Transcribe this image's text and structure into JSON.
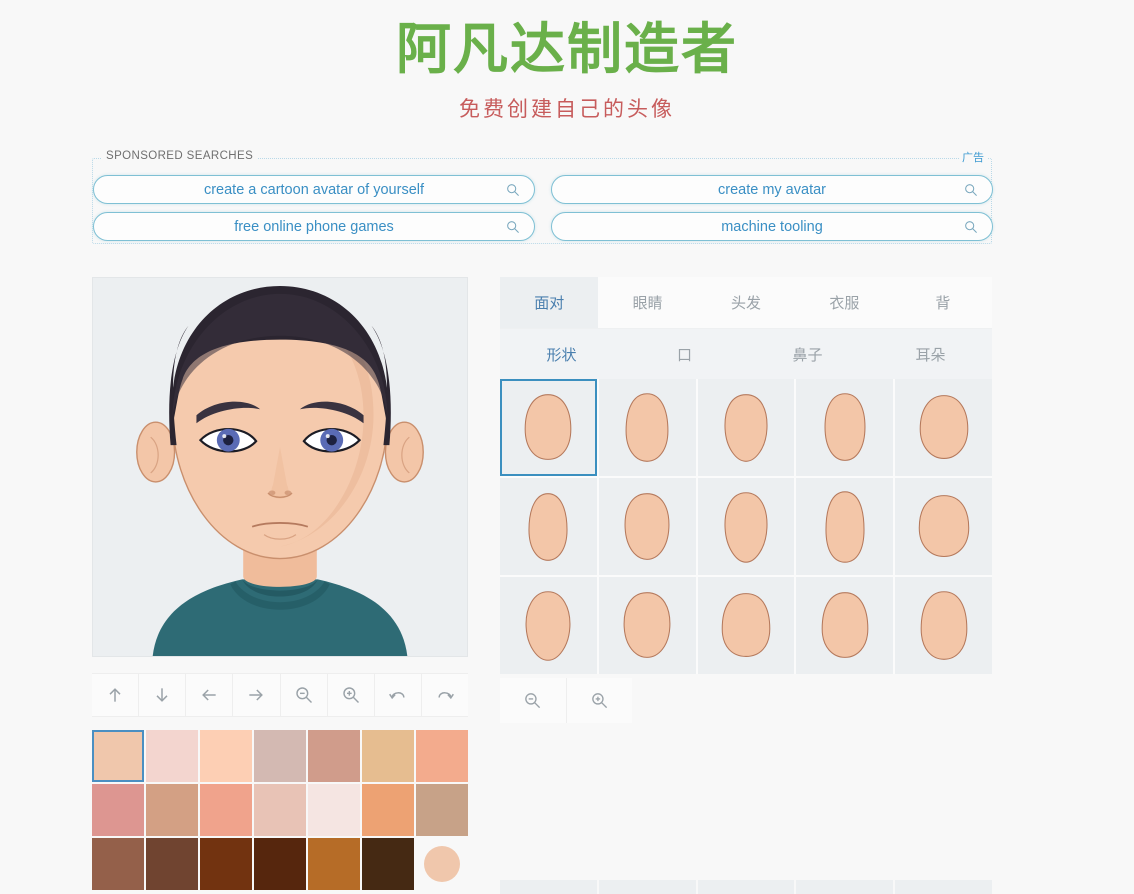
{
  "header": {
    "title": "阿凡达制造者",
    "subtitle": "免费创建自己的头像",
    "title_color": "#6ab04a",
    "subtitle_color": "#c75c5c"
  },
  "ads": {
    "label": "SPONSORED SEARCHES",
    "tag": "广告",
    "items": [
      {
        "text": "create a cartoon avatar of yourself"
      },
      {
        "text": "create my avatar"
      },
      {
        "text": "free online phone games"
      },
      {
        "text": "machine tooling"
      }
    ]
  },
  "avatar": {
    "background": "#eceff1",
    "skin": "#f3c6a8",
    "skin_shadow": "#e8b495",
    "hair": "#2b2530",
    "shirt": "#2e6b75",
    "shirt_dark": "#245a63",
    "eye_iris": "#5a6bb5",
    "eye_pupil": "#1d2140",
    "brow": "#3a3340",
    "outline": "#b07a5d"
  },
  "toolbar": {
    "buttons": [
      {
        "name": "move-up",
        "icon": "arrow-up-icon"
      },
      {
        "name": "move-down",
        "icon": "arrow-down-icon"
      },
      {
        "name": "move-left",
        "icon": "arrow-left-icon"
      },
      {
        "name": "move-right",
        "icon": "arrow-right-icon"
      },
      {
        "name": "zoom-out",
        "icon": "zoom-out-icon"
      },
      {
        "name": "zoom-in",
        "icon": "zoom-in-icon"
      },
      {
        "name": "undo",
        "icon": "undo-icon"
      },
      {
        "name": "redo",
        "icon": "redo-icon"
      }
    ]
  },
  "palette": {
    "selected_index": 0,
    "colors": [
      "#f0c7ac",
      "#f3d5cf",
      "#fdcfb4",
      "#d3b9b2",
      "#d09c8b",
      "#e6bd90",
      "#f3ab8d",
      "#dd9691",
      "#d3a084",
      "#f0a38c",
      "#e8c3b6",
      "#f5e5e2",
      "#eda273",
      "#c7a288",
      "#94604a",
      "#704430",
      "#723310",
      "#56260d",
      "#b66c27",
      "#452913"
    ],
    "current_color": "#f0c7ac"
  },
  "panel": {
    "tabs": [
      {
        "label": "面对",
        "active": true
      },
      {
        "label": "眼睛",
        "active": false
      },
      {
        "label": "头发",
        "active": false
      },
      {
        "label": "衣服",
        "active": false
      },
      {
        "label": "背",
        "active": false
      }
    ],
    "subtabs": [
      {
        "label": "形状",
        "active": true
      },
      {
        "label": "口",
        "active": false
      },
      {
        "label": "鼻子",
        "active": false
      },
      {
        "label": "耳朵",
        "active": false
      }
    ],
    "thumb_fill": "#f3c6a8",
    "thumb_stroke": "#b5795c",
    "selected_thumb": 0,
    "shapes": [
      "oval-wide",
      "oval-tall",
      "oval-pointed",
      "egg",
      "round",
      "oval-narrow",
      "oval-soft",
      "teardrop",
      "egg-long",
      "round-wide",
      "diamond",
      "heart",
      "square-soft",
      "bell",
      "round-tall"
    ],
    "grid_tools": [
      {
        "name": "grid-zoom-out",
        "icon": "zoom-out-icon"
      },
      {
        "name": "grid-zoom-in",
        "icon": "zoom-in-icon"
      }
    ]
  }
}
